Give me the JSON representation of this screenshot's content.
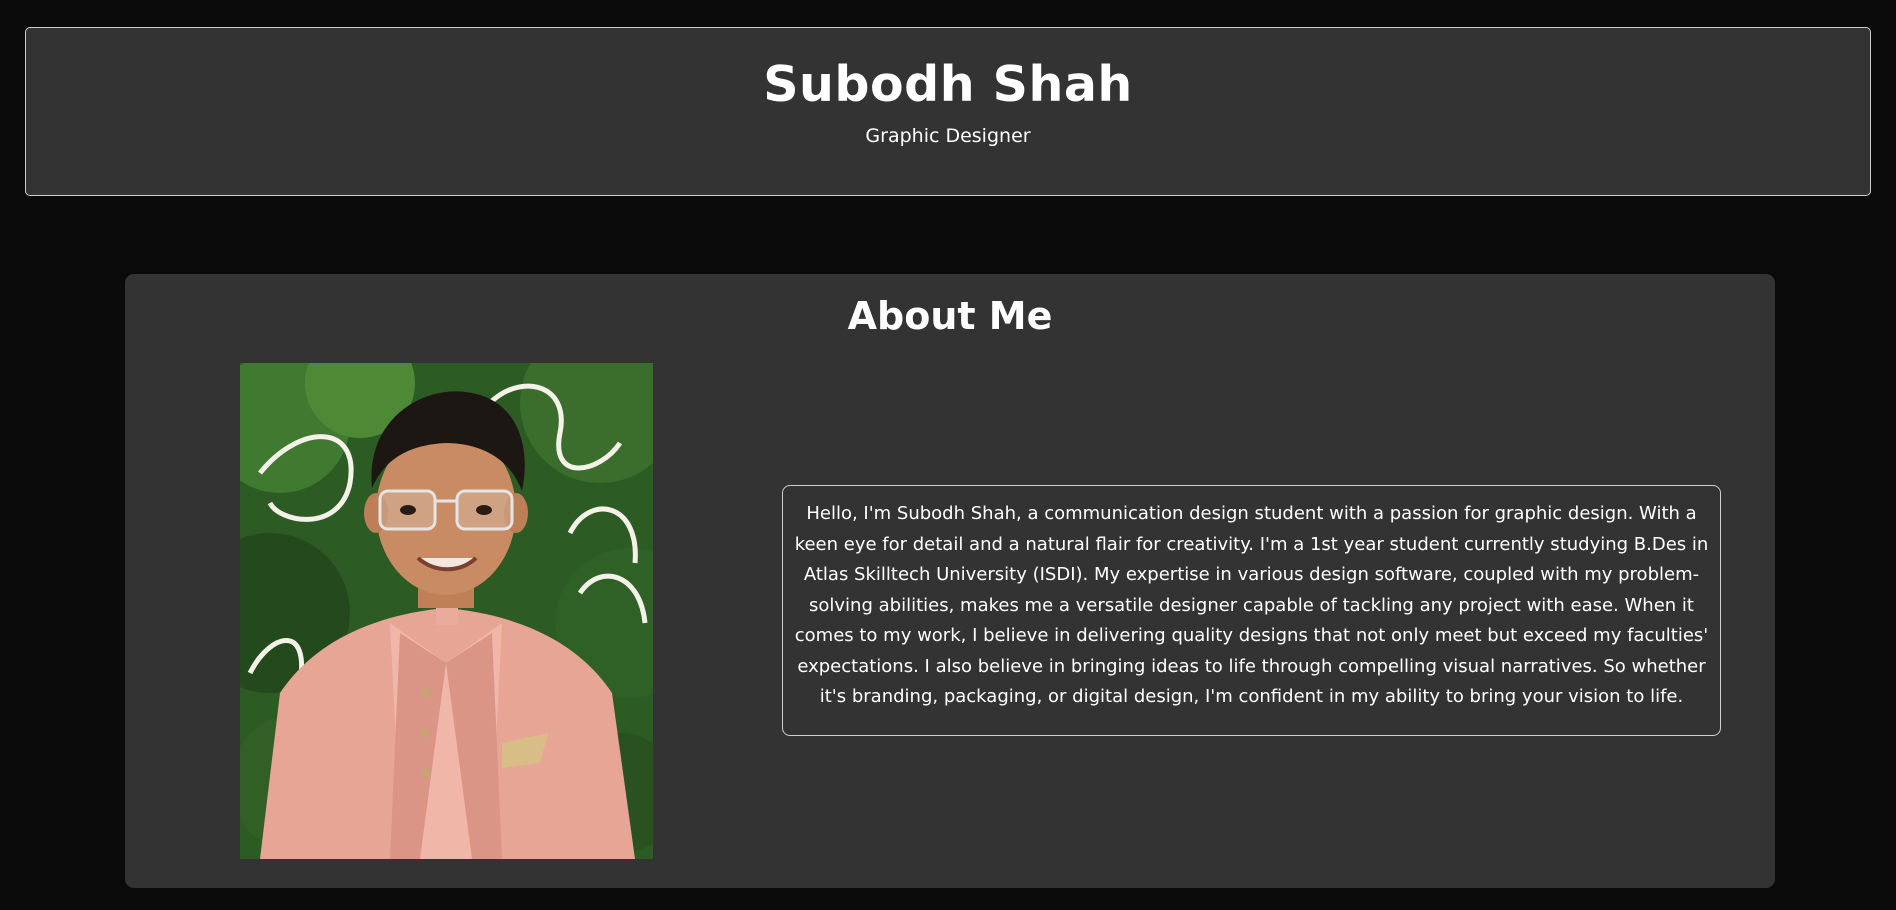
{
  "header": {
    "name": "Subodh Shah",
    "role": "Graphic Designer"
  },
  "about": {
    "heading": "About Me",
    "bio": "Hello, I'm Subodh Shah, a communication design student with a passion for graphic design. With a keen eye for detail and a natural flair for creativity. I'm a 1st year student currently studying B.Des in Atlas Skilltech University (ISDI). My expertise in various design software, coupled with my problem-solving abilities, makes me a versatile designer capable of tackling any project with ease. When it comes to my work, I believe in delivering quality designs that not only meet but exceed my faculties' expectations. I also believe in bringing ideas to life through compelling visual narratives. So whether it's branding, packaging, or digital design, I'm confident in my ability to bring your vision to life.",
    "photo": {
      "subject": "portrait-photo",
      "colors": {
        "foliage": "#2c5a22",
        "jacket": "#e8a79b",
        "skin": "#c98b63",
        "hair": "#1d1714"
      }
    }
  }
}
